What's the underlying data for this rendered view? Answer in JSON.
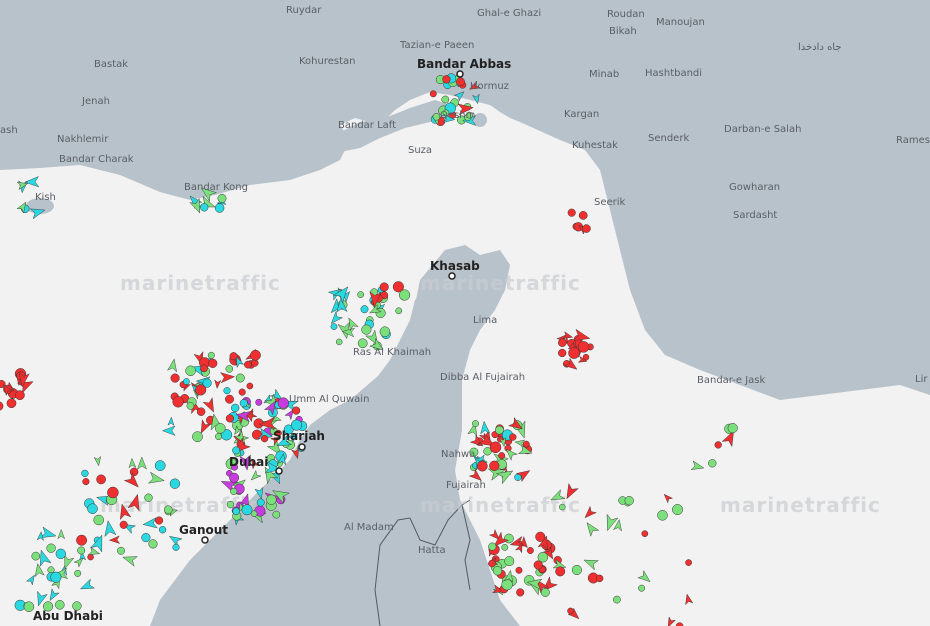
{
  "colors": {
    "sea": "#f2f2f2",
    "land": "#b8c2ca",
    "border": "#555a60",
    "ship_red": "#f03030",
    "ship_green": "#7be07b",
    "ship_cyan": "#29d8e0",
    "ship_magenta": "#c63cdc",
    "ship_blue": "#3060e8",
    "ship_pink": "#f39aa0"
  },
  "watermark": "marinetraffic",
  "places": {
    "ruydar": "Ruydar",
    "ghale_ghazi": "Ghal-e Ghazi",
    "roudan": "Roudan",
    "bikah": "Bikah",
    "manoujan": "Manoujan",
    "jaah_dadkha": "جاه دادخدا",
    "bastak": "Bastak",
    "kohurestan": "Kohurestan",
    "tazian": "Tazian-e Paeen",
    "bandar_abbas": "Bandar Abbas",
    "hormuz": "Hormuz",
    "minab": "Minab",
    "hashtbandi": "Hashtbandi",
    "jenah": "Jenah",
    "bandar_laft": "Bandar Laft",
    "qeshm": "Qeshm",
    "kargan": "Kargan",
    "nakhlemir": "Nakhlemir",
    "ash": "ash",
    "bandar_charak": "Bandar Charak",
    "suza": "Suza",
    "kuhestak": "Kuhestak",
    "senderk": "Senderk",
    "darbar": "Darban-e Salah",
    "rames": "Rames",
    "kish": "Kish",
    "bandar_kong": "Bandar Kong",
    "gowharan": "Gowharan",
    "seerik": "Seerik",
    "sardasht": "Sardasht",
    "khasab": "Khasab",
    "lima": "Lima",
    "ras_al_khaimah": "Ras Al Khaimah",
    "dibba": "Dibba Al Fujairah",
    "bandar_jask": "Bandar-e Jask",
    "lir": "Lir",
    "umm_al_quwain": "Umm Al Quwain",
    "sharjah": "Sharjah",
    "dubai": "Dubai",
    "nahwa": "Nahwa",
    "fujairah": "Fujairah",
    "ganout": "Ganout",
    "al_madam": "Al Madam",
    "hatta": "Hatta",
    "abu_dhabi": "Abu Dhabi"
  }
}
